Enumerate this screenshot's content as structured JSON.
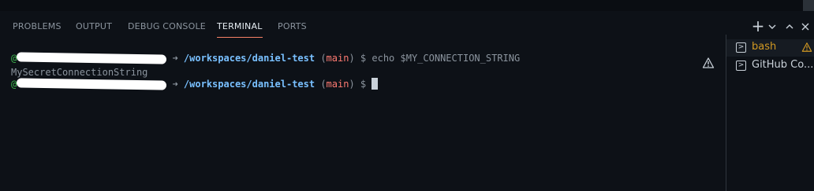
{
  "tabs": [
    {
      "label": "PROBLEMS"
    },
    {
      "label": "OUTPUT"
    },
    {
      "label": "DEBUG CONSOLE"
    },
    {
      "label": "TERMINAL",
      "active": true
    },
    {
      "label": "PORTS"
    }
  ],
  "actions": {
    "add_icon": "plus-icon",
    "dropdown_icon": "chevron-down-icon",
    "maximize_icon": "chevron-up-icon",
    "close_icon": "close-icon"
  },
  "terminal": {
    "prompt_at": "@",
    "arrow": " ➜ ",
    "path": "/workspaces/daniel-test",
    "branch_open": " (",
    "branch": "main",
    "branch_close": ")",
    "dollar": " $ ",
    "command": "echo $MY_CONNECTION_STRING",
    "output": "MySecretConnectionString"
  },
  "sidebar": {
    "items": [
      {
        "label": "bash",
        "warning": true
      },
      {
        "label": "GitHub Co..."
      }
    ]
  },
  "colors": {
    "accent": "#f78166",
    "green": "#3fb950",
    "path_blue": "#79c0ff",
    "branch_red": "#ff7b72",
    "warning": "#d29922"
  }
}
